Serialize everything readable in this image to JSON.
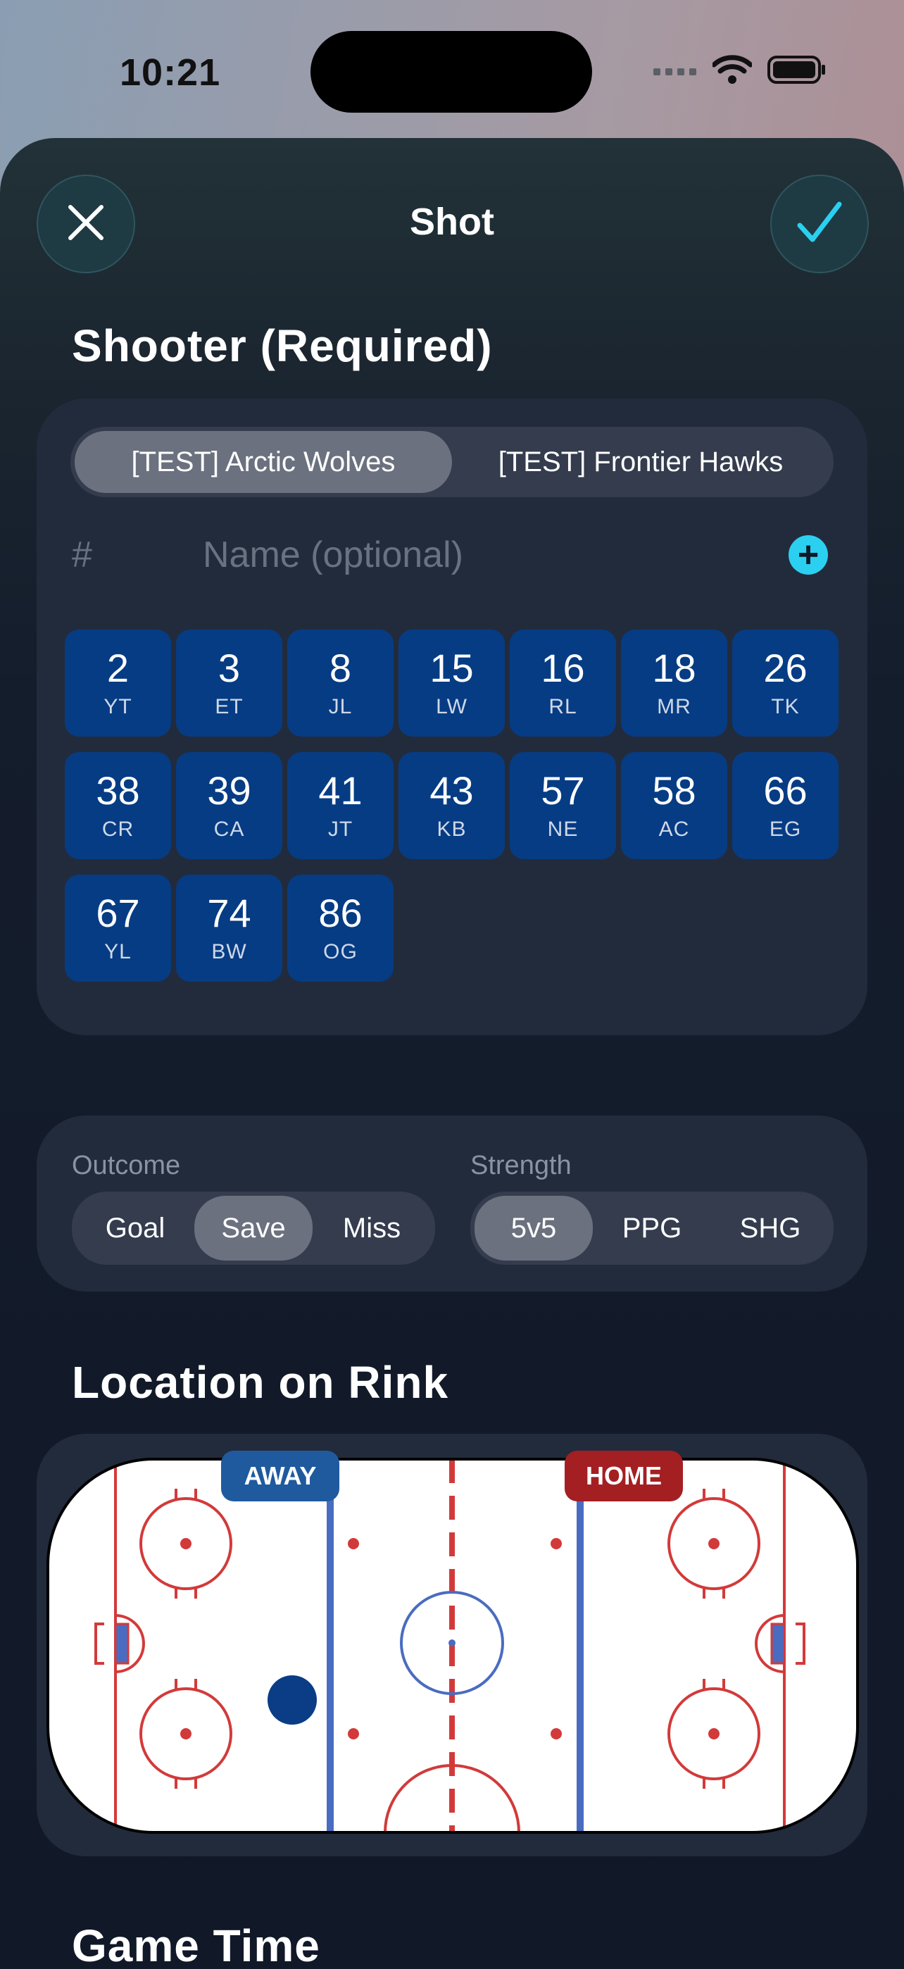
{
  "status": {
    "time": "10:21"
  },
  "sheet": {
    "title": "Shot"
  },
  "shooter": {
    "heading": "Shooter (Required)",
    "teams": [
      {
        "label": "[TEST] Arctic Wolves",
        "selected": true
      },
      {
        "label": "[TEST] Frontier Hawks",
        "selected": false
      }
    ],
    "number_placeholder": "#",
    "name_placeholder": "Name (optional)",
    "players": [
      {
        "number": "2",
        "initials": "YT"
      },
      {
        "number": "3",
        "initials": "ET"
      },
      {
        "number": "8",
        "initials": "JL"
      },
      {
        "number": "15",
        "initials": "LW"
      },
      {
        "number": "16",
        "initials": "RL"
      },
      {
        "number": "18",
        "initials": "MR"
      },
      {
        "number": "26",
        "initials": "TK"
      },
      {
        "number": "38",
        "initials": "CR"
      },
      {
        "number": "39",
        "initials": "CA"
      },
      {
        "number": "41",
        "initials": "JT"
      },
      {
        "number": "43",
        "initials": "KB"
      },
      {
        "number": "57",
        "initials": "NE"
      },
      {
        "number": "58",
        "initials": "AC"
      },
      {
        "number": "66",
        "initials": "EG"
      },
      {
        "number": "67",
        "initials": "YL"
      },
      {
        "number": "74",
        "initials": "BW"
      },
      {
        "number": "86",
        "initials": "OG"
      }
    ]
  },
  "outcome": {
    "label": "Outcome",
    "options": [
      {
        "label": "Goal",
        "selected": false
      },
      {
        "label": "Save",
        "selected": true
      },
      {
        "label": "Miss",
        "selected": false
      }
    ]
  },
  "strength": {
    "label": "Strength",
    "options": [
      {
        "label": "5v5",
        "selected": true
      },
      {
        "label": "PPG",
        "selected": false
      },
      {
        "label": "SHG",
        "selected": false
      }
    ]
  },
  "location": {
    "heading": "Location on Rink",
    "away_label": "AWAY",
    "home_label": "HOME"
  },
  "game_time": {
    "heading": "Game Time"
  },
  "colors": {
    "accent": "#2bd0f0",
    "player_button": "#063c84",
    "away": "#1f5a9e",
    "home": "#a41f22",
    "rink_red": "#d23a3a",
    "rink_blue": "#4a6cc0",
    "puck": "#0a3d85"
  },
  "icons": {
    "close": "close-icon",
    "confirm": "checkmark-icon",
    "add": "plus-icon",
    "signal": "cellular-signal-icon",
    "wifi": "wifi-icon",
    "battery": "battery-icon"
  }
}
